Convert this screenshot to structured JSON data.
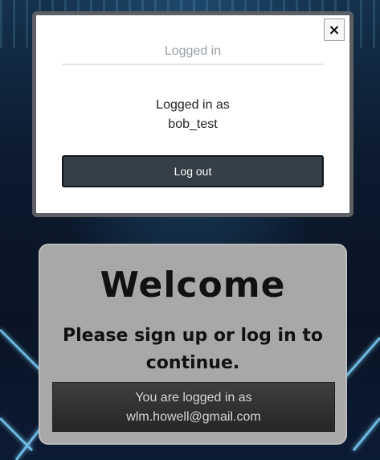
{
  "dialog": {
    "close_label": "×",
    "tab_title": "Logged in",
    "logged_in_line1": "Logged in as",
    "logged_in_user": "bob_test",
    "logout_label": "Log out"
  },
  "welcome": {
    "title": "Welcome",
    "subtitle": "Please sign up or log in to continue.",
    "status_line1": "You are logged in as",
    "status_email": "wlm.howell@gmail.com"
  },
  "colors": {
    "dialog_border": "#5c5f63",
    "logout_button": "#343f47",
    "card_background": "#a8a8a8",
    "status_box": "#2e2e2e",
    "neon_accent": "#7fd4ff"
  }
}
